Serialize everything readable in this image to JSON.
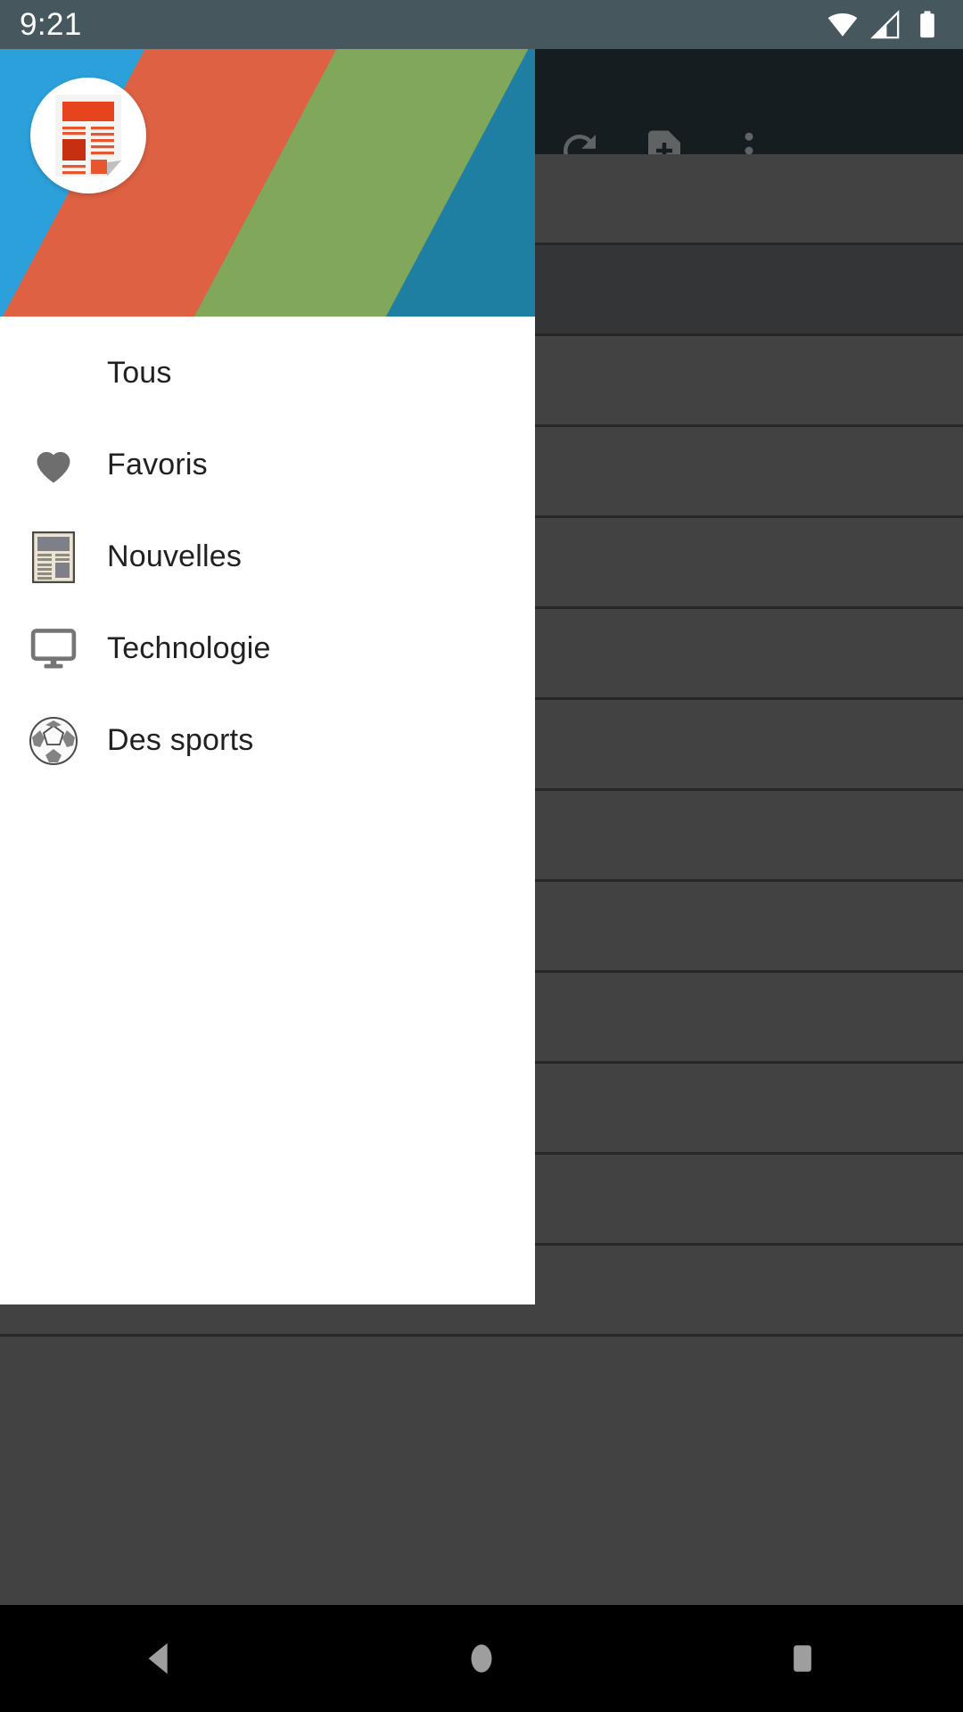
{
  "status_bar": {
    "time": "9:21",
    "icons": [
      "wifi-icon",
      "cellular-signal-icon",
      "battery-icon"
    ],
    "background_color": "#46575e"
  },
  "background_app": {
    "toolbar": {
      "background_color": "#242f35",
      "actions": [
        {
          "name": "refresh-button",
          "icon": "refresh-icon"
        },
        {
          "name": "add-document-button",
          "icon": "note-add-icon"
        },
        {
          "name": "overflow-menu-button",
          "icon": "more-vertical-icon"
        }
      ]
    },
    "list": {
      "row_count": 13,
      "row_color": "#6b6b6b",
      "alt_row_color": "#555657",
      "divider_color": "#3f3f3f",
      "highlighted_row_index": 1
    }
  },
  "drawer": {
    "header": {
      "logo_icon": "newspaper-logo-icon",
      "stripe_colors": [
        "#2ca0db",
        "#dd6142",
        "#81a85a",
        "#1f7fa3"
      ]
    },
    "items": [
      {
        "label": "Tous",
        "icon": "none",
        "name": "drawer-item-tous"
      },
      {
        "label": "Favoris",
        "icon": "heart-icon",
        "name": "drawer-item-favoris"
      },
      {
        "label": "Nouvelles",
        "icon": "newspaper-icon",
        "name": "drawer-item-nouvelles"
      },
      {
        "label": "Technologie",
        "icon": "monitor-icon",
        "name": "drawer-item-technologie"
      },
      {
        "label": "Des sports",
        "icon": "soccer-ball-icon",
        "name": "drawer-item-des-sports"
      }
    ]
  },
  "navigation_bar": {
    "buttons": [
      {
        "label": "Back",
        "icon": "back-triangle-icon",
        "name": "nav-back-button"
      },
      {
        "label": "Home",
        "icon": "home-circle-icon",
        "name": "nav-home-button"
      },
      {
        "label": "Recents",
        "icon": "recents-square-icon",
        "name": "nav-recents-button"
      }
    ],
    "background_color": "#000000",
    "icon_color": "#9e9e9e"
  }
}
